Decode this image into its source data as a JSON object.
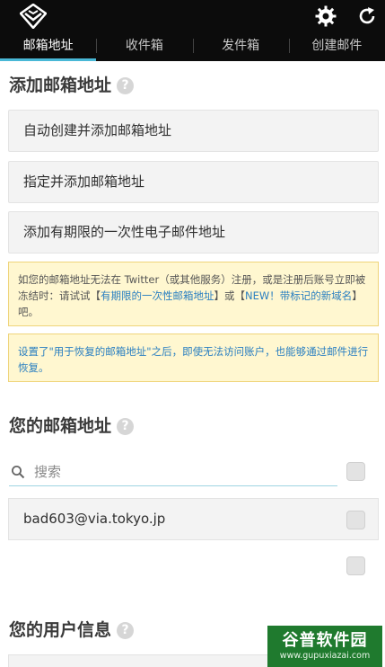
{
  "header": {
    "logo_icon": "mailbox-logo-icon",
    "settings_icon": "gear-icon",
    "refresh_icon": "refresh-icon"
  },
  "tabs": [
    {
      "label": "邮箱地址",
      "active": true
    },
    {
      "label": "收件箱",
      "active": false
    },
    {
      "label": "发件箱",
      "active": false
    },
    {
      "label": "创建邮件",
      "active": false
    }
  ],
  "add_section": {
    "title": "添加邮箱地址",
    "help": "?",
    "buttons": [
      {
        "label": "自动创建并添加邮箱地址"
      },
      {
        "label": "指定并添加邮箱地址"
      },
      {
        "label": "添加有期限的一次性电子邮件地址"
      }
    ]
  },
  "notices": {
    "twitter": {
      "text_before": "如您的邮箱地址无法在 Twitter（或其他服务）注册，或是注册后账号立即被冻结时：请试试【",
      "link1": "有期限的一次性邮箱地址",
      "text_middle": "】或【",
      "link2": "NEW！带标记的新域名",
      "text_after": "】吧。"
    },
    "recovery": {
      "text": "设置了\"用于恢复的邮箱地址\"之后，即使无法访问账户，也能够通过邮件进行恢复。"
    }
  },
  "addresses_section": {
    "title": "您的邮箱地址",
    "help": "?",
    "search": {
      "placeholder": "搜索",
      "value": ""
    },
    "items": [
      {
        "address": "bad603@via.tokyo.jp"
      }
    ]
  },
  "user_section": {
    "title": "您的用户信息",
    "help": "?"
  },
  "watermark": {
    "main": "谷普软件园",
    "sub": "www.gupuxiazai.com"
  },
  "colors": {
    "topbar": "#0c0c0c",
    "tab_indicator": "#49b8d6",
    "notice_bg": "#fff7d0",
    "link": "#2a7fc1"
  }
}
